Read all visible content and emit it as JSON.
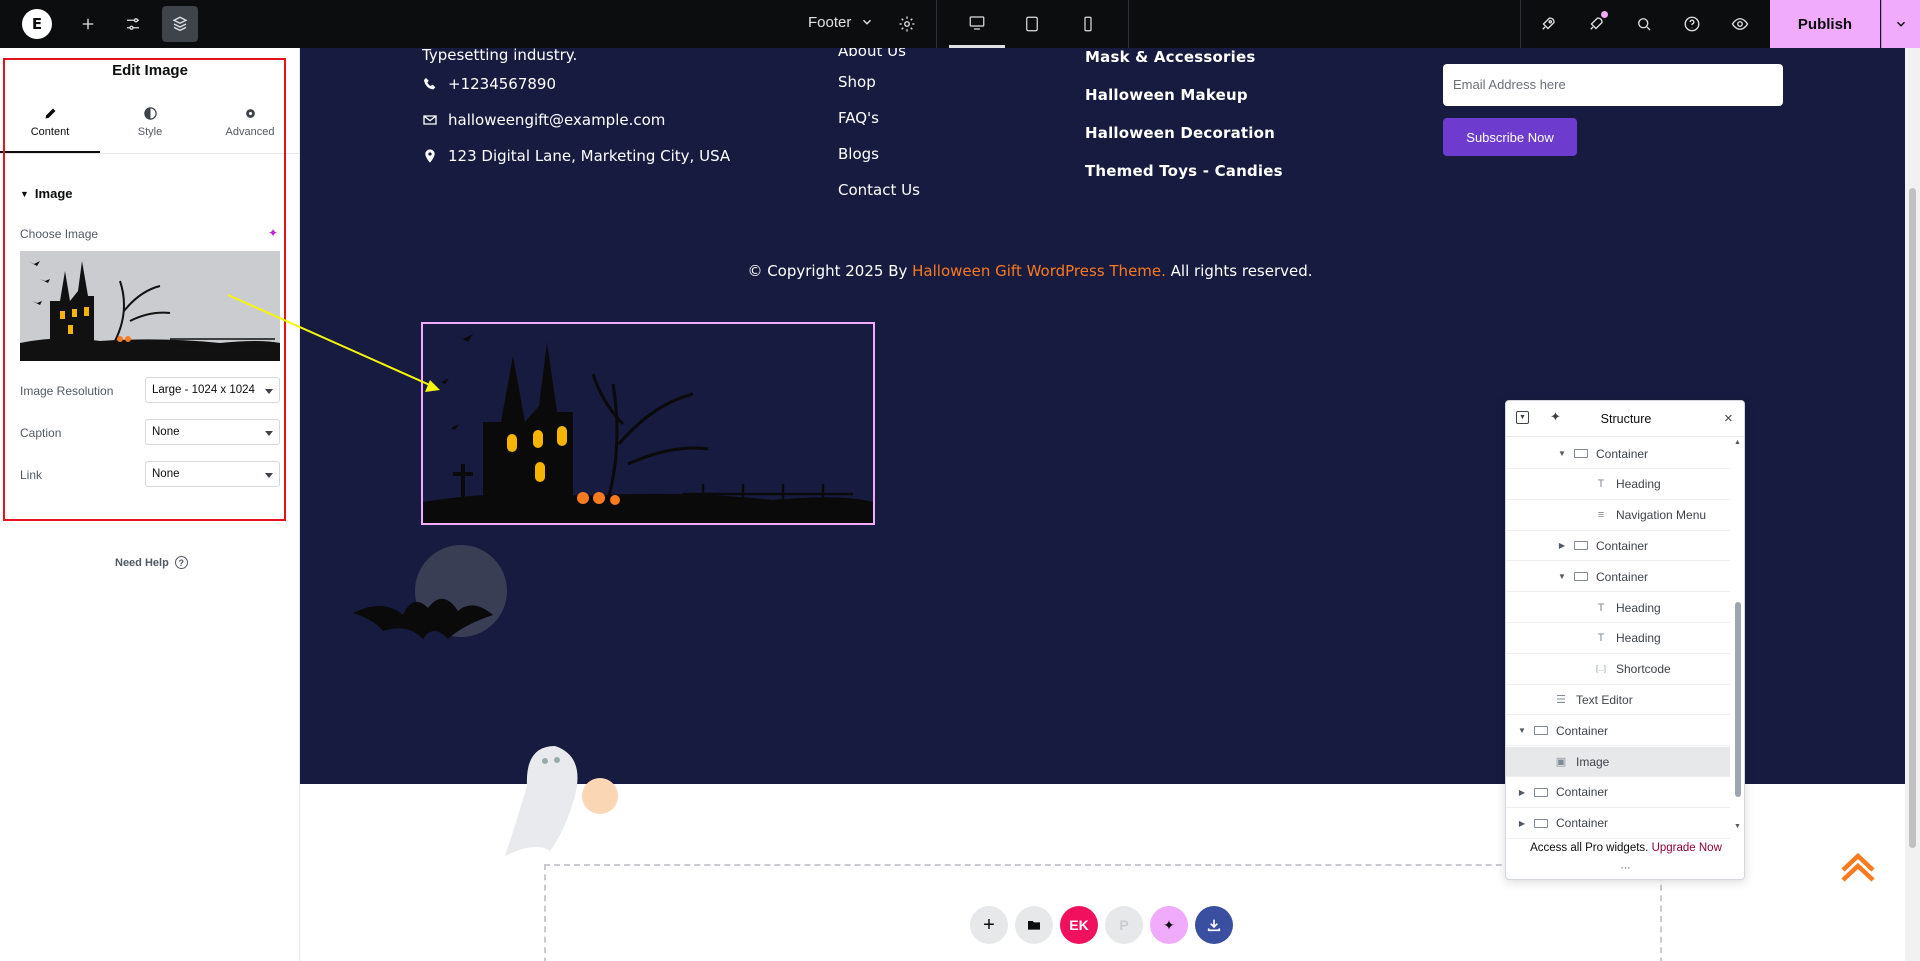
{
  "topbar": {
    "logo": "E",
    "document_title": "Footer",
    "publish_label": "Publish",
    "icons": [
      "add-icon",
      "settings-sliders-icon",
      "structure-layers-icon",
      "gear-icon",
      "desktop-icon",
      "tablet-icon",
      "mobile-icon",
      "rocket-icon",
      "notifications-icon",
      "search-icon",
      "help-icon",
      "preview-eye-icon",
      "chevron-down-icon"
    ]
  },
  "panel": {
    "title": "Edit Image",
    "tabs": [
      {
        "label": "Content",
        "icon": "pencil-icon"
      },
      {
        "label": "Style",
        "icon": "half-circle-icon"
      },
      {
        "label": "Advanced",
        "icon": "gear-icon"
      }
    ],
    "section": "Image",
    "choose_image_label": "Choose Image",
    "controls": [
      {
        "label": "Image Resolution",
        "value": "Large - 1024 x 1024"
      },
      {
        "label": "Caption",
        "value": "None"
      },
      {
        "label": "Link",
        "value": "None"
      }
    ],
    "need_help": "Need Help"
  },
  "canvas": {
    "truncated_text": "Typesetting industry.",
    "contacts": [
      {
        "icon": "phone-icon",
        "text": "+1234567890"
      },
      {
        "icon": "email-icon",
        "text": "halloweengift@example.com"
      },
      {
        "icon": "location-icon",
        "text": "123 Digital Lane, Marketing City, USA"
      }
    ],
    "quick_links": [
      "About Us",
      "Shop",
      "FAQ's",
      "Blogs",
      "Contact Us"
    ],
    "categories": [
      "Mask & Accessories",
      "Halloween Makeup",
      "Halloween Decoration",
      "Themed Toys - Candies"
    ],
    "newsletter": {
      "placeholder": "Email Address here",
      "button": "Subscribe Now"
    },
    "copyright": {
      "prefix": "© Copyright 2025 By ",
      "link": "Halloween Gift WordPress Theme.",
      "suffix": " All rights reserved."
    },
    "drop_zone_buttons": [
      "add-section-icon",
      "template-library-icon",
      "elementskit-icon",
      "pro-icon",
      "ai-icon",
      "import-icon"
    ],
    "colors": {
      "footer_bg": "#171b3f",
      "accent": "#f97a1f",
      "subscribe": "#6d3ccf",
      "publish": "#f0abfc"
    }
  },
  "structure": {
    "title": "Structure",
    "rows": [
      {
        "label": "Container",
        "indent": 2,
        "toggle": "open",
        "icon": "container"
      },
      {
        "label": "Heading",
        "indent": 3,
        "toggle": "",
        "icon": "heading"
      },
      {
        "label": "Navigation Menu",
        "indent": 3,
        "toggle": "",
        "icon": "menu"
      },
      {
        "label": "Container",
        "indent": 2,
        "toggle": "closed",
        "icon": "container"
      },
      {
        "label": "Container",
        "indent": 2,
        "toggle": "open",
        "icon": "container"
      },
      {
        "label": "Heading",
        "indent": 3,
        "toggle": "",
        "icon": "heading"
      },
      {
        "label": "Heading",
        "indent": 3,
        "toggle": "",
        "icon": "heading"
      },
      {
        "label": "Shortcode",
        "indent": 3,
        "toggle": "",
        "icon": "shortcode"
      },
      {
        "label": "Text Editor",
        "indent": 1,
        "toggle": "",
        "icon": "text"
      },
      {
        "label": "Container",
        "indent": 0,
        "toggle": "open",
        "icon": "container"
      },
      {
        "label": "Image",
        "indent": 1,
        "toggle": "",
        "icon": "image",
        "selected": true
      },
      {
        "label": "Container",
        "indent": 0,
        "toggle": "closed",
        "icon": "container"
      },
      {
        "label": "Container",
        "indent": 0,
        "toggle": "closed",
        "icon": "container"
      }
    ],
    "footer_text": "Access all Pro widgets.",
    "footer_link": "Upgrade Now"
  }
}
